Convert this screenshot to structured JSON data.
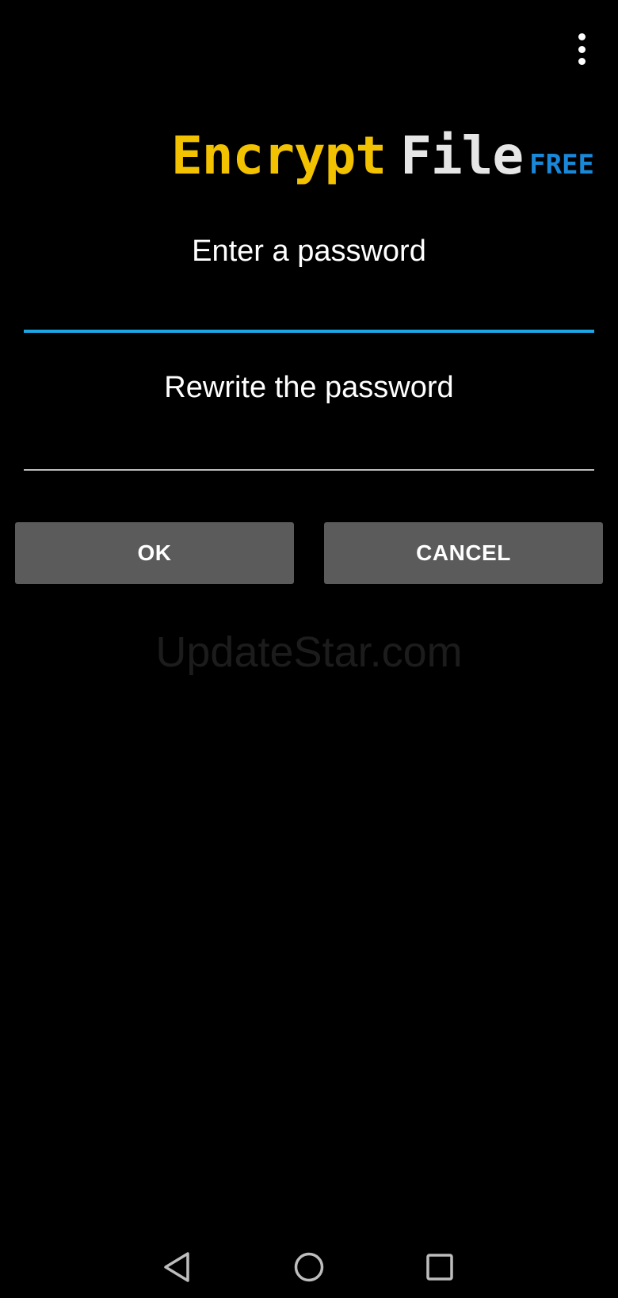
{
  "app_bar": {
    "overflow_icon": "more-vert-icon"
  },
  "logo": {
    "word1": "Encrypt",
    "word2": "File",
    "word3": "FREE",
    "colors": {
      "word1": "#f2c200",
      "word2": "#e6e6e6",
      "word3": "#1a88d8"
    }
  },
  "form": {
    "password_label": "Enter a password",
    "password_value": "",
    "confirm_label": "Rewrite the password",
    "confirm_value": "",
    "focus_color": "#1ea6e4"
  },
  "buttons": {
    "ok_label": "OK",
    "cancel_label": "CANCEL"
  },
  "watermark": "UpdateStar.com",
  "nav_bar": {
    "back_icon": "back-triangle-icon",
    "home_icon": "home-circle-icon",
    "recents_icon": "recents-square-icon"
  }
}
